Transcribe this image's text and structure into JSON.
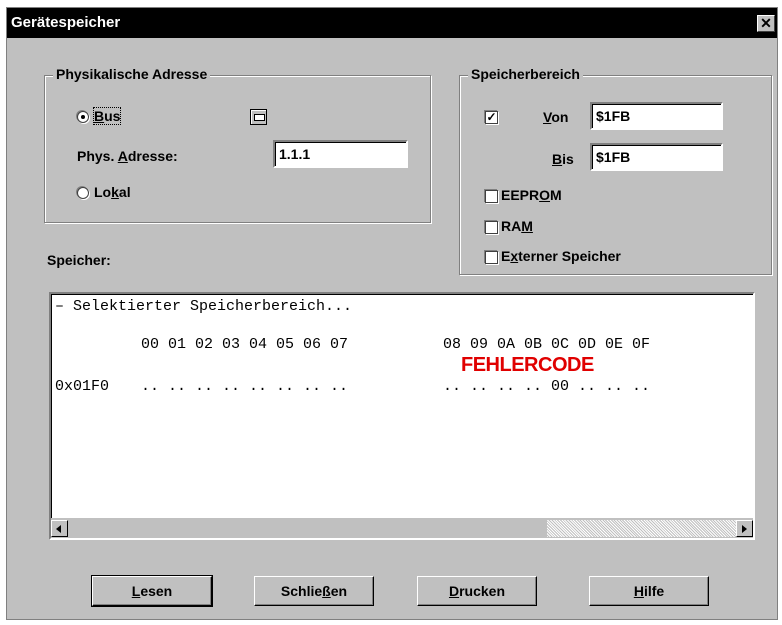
{
  "window": {
    "title": "Gerätespeicher",
    "close_glyph": "✕"
  },
  "phys_group": {
    "legend": "Physikalische Adresse",
    "bus": {
      "pre": "",
      "acc": "B",
      "post": "us",
      "checked": true
    },
    "phys_label": {
      "pre": "Phys. ",
      "acc": "A",
      "post": "dresse:"
    },
    "phys_value": "1.1.1",
    "lokal": {
      "pre": "Lo",
      "acc": "k",
      "post": "al",
      "checked": false
    },
    "device_icon": "device-icon"
  },
  "mem_group": {
    "legend": "Speicherbereich",
    "von_checked": true,
    "check_glyph": "✓",
    "von": {
      "pre": "",
      "acc": "V",
      "post": "on"
    },
    "von_value": "$1FB",
    "bis": {
      "pre": "",
      "acc": "B",
      "post": "is"
    },
    "bis_value": "$1FB",
    "eeprom": {
      "pre": "EEPR",
      "acc": "O",
      "post": "M",
      "checked": false
    },
    "ram": {
      "pre": "RA",
      "acc": "M",
      "post": "",
      "checked": false
    },
    "extern": {
      "pre": "E",
      "acc": "x",
      "post": "terner Speicher",
      "checked": false
    }
  },
  "speicher_label": "Speicher:",
  "memview": {
    "line1": "– Selektierter Speicherbereich...",
    "header_a": "00 01 02 03 04 05 06 07",
    "header_b": "08 09 0A 0B 0C 0D 0E 0F",
    "address": "0x01F0",
    "row_a": ".. .. .. .. .. .. .. ..",
    "row_b": ".. .. .. .. 00 .. .. ..",
    "error": "FEHLERCODE"
  },
  "buttons": {
    "lesen": {
      "pre": "",
      "acc": "L",
      "post": "esen"
    },
    "schliessen": {
      "pre": "Schlie",
      "acc": "ß",
      "post": "en"
    },
    "drucken": {
      "pre": "",
      "acc": "D",
      "post": "rucken"
    },
    "hilfe": {
      "pre": "",
      "acc": "H",
      "post": "ilfe"
    }
  },
  "colors": {
    "titlebar": "#000000",
    "dialog": "#c0c0c0",
    "error": "#e00000"
  }
}
